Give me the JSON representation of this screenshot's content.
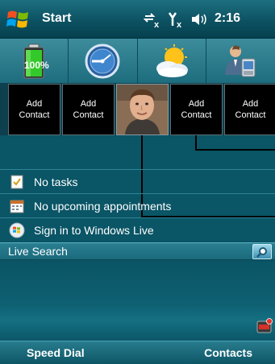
{
  "titlebar": {
    "start_label": "Start",
    "clock": "2:16",
    "icons": [
      "windows-flag-icon",
      "data-connection-icon",
      "no-signal-icon",
      "speaker-icon"
    ]
  },
  "tiles": {
    "battery_percent": "100%",
    "items": [
      "battery-icon",
      "clock-icon",
      "weather-icon",
      "contacts-icon"
    ]
  },
  "contacts": {
    "slots": [
      {
        "type": "add",
        "label": "Add\nContact"
      },
      {
        "type": "add",
        "label": "Add\nContact"
      },
      {
        "type": "photo",
        "icon": "contact-photo"
      },
      {
        "type": "add",
        "label": "Add\nContact"
      },
      {
        "type": "add",
        "label": "Add\nContact"
      }
    ]
  },
  "list": {
    "tasks": "No tasks",
    "appointments": "No upcoming appointments",
    "windows_live": "Sign in to Windows Live"
  },
  "search": {
    "value": "Live Search"
  },
  "softkeys": {
    "left": "Speed Dial",
    "right": "Contacts"
  },
  "colors": {
    "background": "#0a5566",
    "titlebar": "#0c5262",
    "accent": "#2f8597"
  }
}
